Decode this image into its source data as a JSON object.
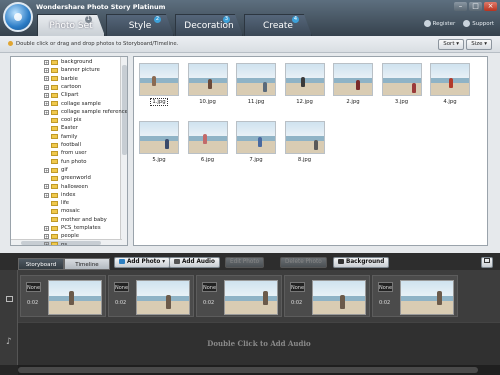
{
  "app": {
    "title": "Wondershare Photo Story Platinum"
  },
  "tabs": [
    {
      "label": "Photo Set",
      "badge": "1"
    },
    {
      "label": "Style",
      "badge": "2"
    },
    {
      "label": "Decoration",
      "badge": "3"
    },
    {
      "label": "Create",
      "badge": "4"
    }
  ],
  "toplinks": {
    "register": "Register",
    "support": "Support"
  },
  "infobar": {
    "hint": "Double click or drag and drop photos to Storyboard/Timeline.",
    "sort": "Sort",
    "size": "Size"
  },
  "tree": {
    "items": [
      "background",
      "banner picture",
      "barbie",
      "cartoon",
      "Clipart",
      "collage sample",
      "collage sample reference",
      "cool pix",
      "Easter",
      "family",
      "football",
      "from user",
      "fun photo",
      "gif",
      "greenworld",
      "halloween",
      "index",
      "life",
      "mosaic",
      "mother and baby",
      "PCS_templates",
      "people",
      "ps",
      "real estate"
    ],
    "expandable": [
      true,
      true,
      true,
      true,
      true,
      true,
      true,
      false,
      false,
      false,
      false,
      false,
      false,
      true,
      false,
      true,
      true,
      false,
      false,
      false,
      true,
      true,
      true,
      true
    ]
  },
  "photos": [
    "1.jpg",
    "10.jpg",
    "11.jpg",
    "12.jpg",
    "2.jpg",
    "3.jpg",
    "4.jpg",
    "5.jpg",
    "6.jpg",
    "7.jpg",
    "8.jpg"
  ],
  "storyboard_tabs": {
    "storyboard": "Storyboard",
    "timeline": "Timeline"
  },
  "actions": {
    "add_photo": "Add Photo",
    "add_audio": "Add Audio",
    "edit_photo": "Edit Photo",
    "delete_photo": "Delete Photo",
    "background": "Background"
  },
  "slots": [
    {
      "transition": "None",
      "duration": "0:02"
    },
    {
      "transition": "None",
      "duration": "0:02"
    },
    {
      "transition": "None",
      "duration": "0:02"
    },
    {
      "transition": "None",
      "duration": "0:02"
    },
    {
      "transition": "None",
      "duration": "0:02"
    }
  ],
  "audio_track": {
    "hint": "Double Click to Add Audio"
  }
}
